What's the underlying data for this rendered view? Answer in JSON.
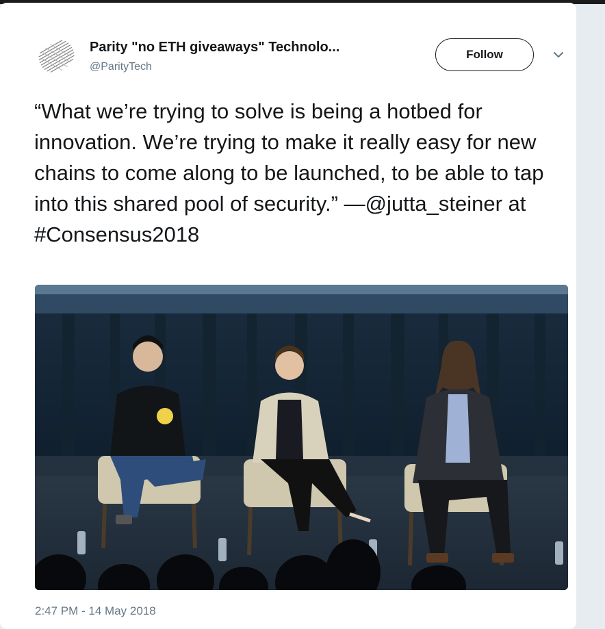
{
  "tweet": {
    "author": {
      "display_name": "Parity \"no ETH giveaways\" Technolo...",
      "handle": "@ParityTech"
    },
    "follow_label": "Follow",
    "text": "“What we’re trying to solve is being a hotbed for innovation. We’re trying to make it really easy for new chains to come along to be launched, to be able to tap into this shared pool of security.” —@jutta_steiner at #Consensus2018",
    "timestamp": "2:47 PM - 14 May 2018"
  },
  "icons": {
    "avatar": "parity-logo-icon",
    "menu": "chevron-down-icon"
  },
  "colors": {
    "text": "#14171a",
    "secondary_text": "#657786",
    "card_background": "#ffffff"
  }
}
